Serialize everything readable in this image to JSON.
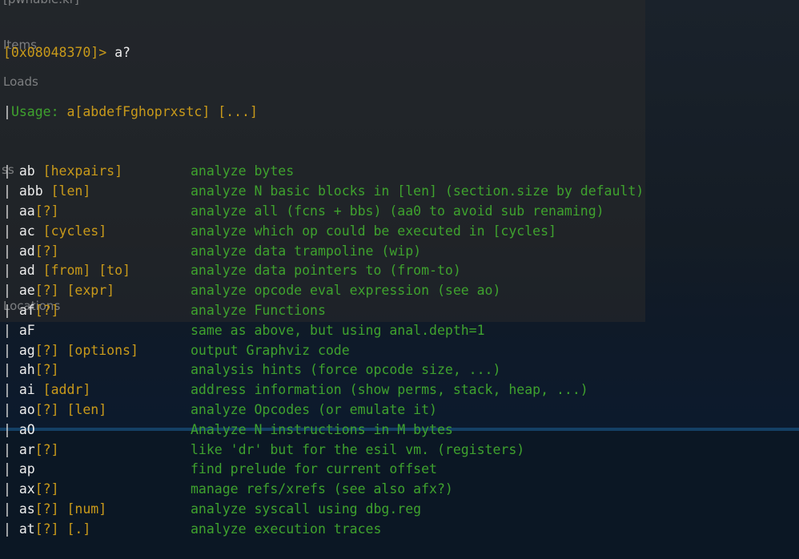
{
  "terminal": {
    "prompt": "[0x08048370]> ",
    "typed_command": "a?",
    "usage_prefix": "Usage: ",
    "usage_text": "a[abdefFghoprxstc] [...]",
    "rows": [
      {
        "cmd": "ab",
        "arg": " [hexpairs]",
        "desc": "analyze bytes"
      },
      {
        "cmd": "abb",
        "arg": " [len]",
        "desc": "analyze N basic blocks in [len] (section.size by default)"
      },
      {
        "cmd": "aa",
        "arg": "[?]",
        "desc": "analyze all (fcns + bbs) (aa0 to avoid sub renaming)"
      },
      {
        "cmd": "ac",
        "arg": " [cycles]",
        "desc": "analyze which op could be executed in [cycles]"
      },
      {
        "cmd": "ad",
        "arg": "[?]",
        "desc": "analyze data trampoline (wip)"
      },
      {
        "cmd": "ad",
        "arg": " [from] [to]",
        "desc": "analyze data pointers to (from-to)"
      },
      {
        "cmd": "ae",
        "arg": "[?] [expr]",
        "desc": "analyze opcode eval expression (see ao)"
      },
      {
        "cmd": "af",
        "arg": "[?]",
        "desc": "analyze Functions"
      },
      {
        "cmd": "aF",
        "arg": "",
        "desc": "same as above, but using anal.depth=1"
      },
      {
        "cmd": "ag",
        "arg": "[?] [options]",
        "desc": "output Graphviz code"
      },
      {
        "cmd": "ah",
        "arg": "[?]",
        "desc": "analysis hints (force opcode size, ...)"
      },
      {
        "cmd": "ai",
        "arg": " [addr]",
        "desc": "address information (show perms, stack, heap, ...)"
      },
      {
        "cmd": "ao",
        "arg": "[?] [len]",
        "desc": "analyze Opcodes (or emulate it)"
      },
      {
        "cmd": "aO",
        "arg": "",
        "desc": "Analyze N instructions in M bytes"
      },
      {
        "cmd": "ar",
        "arg": "[?]",
        "desc": "like 'dr' but for the esil vm. (registers)"
      },
      {
        "cmd": "ap",
        "arg": "",
        "desc": "find prelude for current offset"
      },
      {
        "cmd": "ax",
        "arg": "[?]",
        "desc": "manage refs/xrefs (see also afx?)"
      },
      {
        "cmd": "as",
        "arg": "[?] [num]",
        "desc": "analyze syscall using dbg.reg"
      },
      {
        "cmd": "at",
        "arg": "[?] [.]",
        "desc": "analyze execution traces"
      }
    ]
  },
  "background_ghost_labels": [
    "[pwnable.kr]",
    "Items",
    "Loads",
    "ss",
    "Locations"
  ],
  "colors": {
    "command": "#ececec",
    "argument": "#c99a1a",
    "description": "#3fa22e",
    "background": "#0b1724"
  }
}
